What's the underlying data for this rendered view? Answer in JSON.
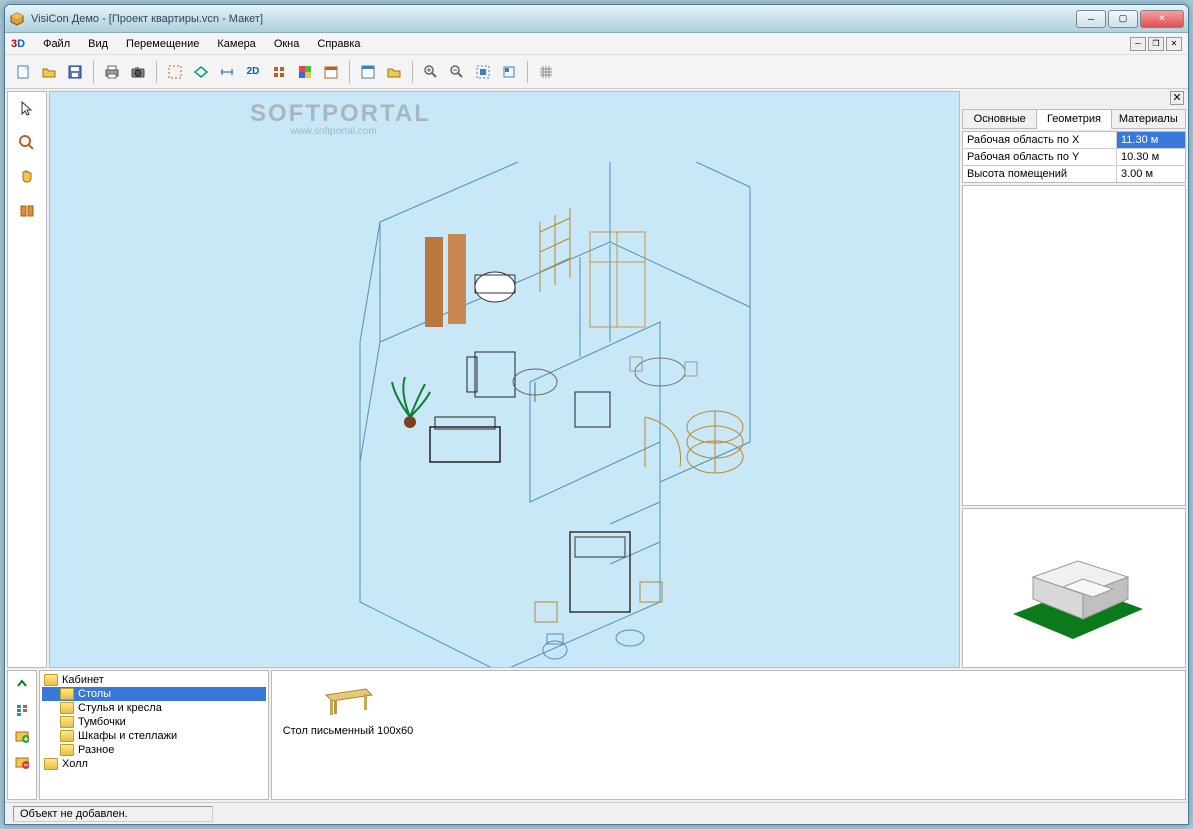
{
  "title": "VisiCon Демо - [Проект квартиры.vcn - Макет]",
  "watermark": "SOFTPORTAL",
  "watermark_sub": "www.softportal.com",
  "menu": {
    "file": "Файл",
    "view": "Вид",
    "move": "Перемещение",
    "camera": "Камера",
    "windows": "Окна",
    "help": "Справка"
  },
  "tabs": {
    "main": "Основные",
    "geometry": "Геометрия",
    "materials": "Материалы"
  },
  "properties": [
    {
      "label": "Рабочая область по X",
      "value": "11.30 м",
      "selected": true
    },
    {
      "label": "Рабочая область по Y",
      "value": "10.30 м",
      "selected": false
    },
    {
      "label": "Высота помещений",
      "value": "3.00 м",
      "selected": false
    }
  ],
  "tree": {
    "root": "Кабинет",
    "items": [
      "Столы",
      "Стулья и кресла",
      "Тумбочки",
      "Шкафы и стеллажи",
      "Разное",
      "Холл"
    ]
  },
  "catalog": {
    "item_label": "Стол письменный 100x60"
  },
  "status": "Объект не добавлен."
}
